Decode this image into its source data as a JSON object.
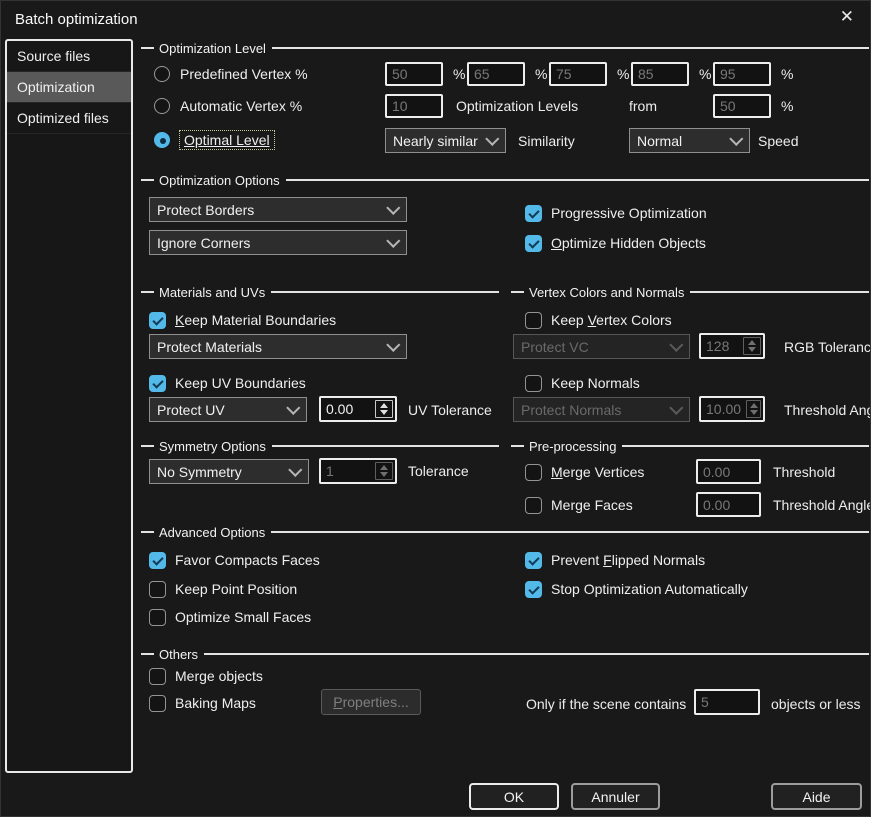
{
  "window": {
    "title": "Batch optimization",
    "close_icon": "✕"
  },
  "colors": {
    "checkbox_accent": "#53b9e9",
    "check_glyph": "#123a52",
    "selected_tab_bg": "#595959"
  },
  "sidebar": {
    "items": [
      {
        "label": "Source files",
        "selected": false
      },
      {
        "label": "Optimization",
        "selected": true
      },
      {
        "label": "Optimized files",
        "selected": false
      }
    ]
  },
  "optimization_level": {
    "header": "Optimization Level",
    "radios": [
      {
        "label": "Predefined Vertex %",
        "selected": false
      },
      {
        "label": "Automatic Vertex %",
        "selected": false
      },
      {
        "label": "Optimal Level",
        "selected": true
      }
    ],
    "predefined_values": [
      "50",
      "65",
      "75",
      "85",
      "95"
    ],
    "percent": "%",
    "auto_value": "10",
    "levels_label": "Optimization Levels",
    "from_label": "from",
    "from_value": "50",
    "similarity_value": "Nearly similar",
    "similarity_label": "Similarity",
    "speed_value": "Normal",
    "speed_label": "Speed"
  },
  "optimization_options": {
    "header": "Optimization Options",
    "protect_borders": "Protect Borders",
    "ignore_corners": "Ignore Corners",
    "progressive": {
      "text": "Progressive Optimization",
      "u": -1,
      "checked": true
    },
    "optimize_hidden": {
      "text": "Optimize Hidden Objects",
      "u": 0,
      "checked": true
    }
  },
  "materials_uvs": {
    "header": "Materials and UVs",
    "keep_material": {
      "text": "Keep Material Boundaries",
      "u": 0,
      "checked": true
    },
    "protect_materials": "Protect Materials",
    "keep_uv": {
      "text": "Keep UV Boundaries",
      "u": -1,
      "checked": true
    },
    "protect_uv": "Protect UV",
    "uv_tolerance_value": "0.00",
    "uv_tolerance_label": "UV Tolerance"
  },
  "vertex_normals": {
    "header": "Vertex Colors and Normals",
    "keep_vc": {
      "text": "Keep Vertex Colors",
      "u": 5,
      "checked": false
    },
    "protect_vc": "Protect VC",
    "rgb_value": "128",
    "rgb_label": "RGB Tolerance",
    "keep_normals": {
      "text": "Keep Normals",
      "u": -1,
      "checked": false
    },
    "protect_normals": "Protect Normals",
    "angle_value": "10.00",
    "angle_label": "Threshold Angle"
  },
  "symmetry": {
    "header": "Symmetry Options",
    "dropdown_value": "No Symmetry",
    "tolerance_value": "1",
    "tolerance_label": "Tolerance"
  },
  "preprocessing": {
    "header": "Pre-processing",
    "merge_vertices": {
      "text": "Merge Vertices",
      "u": 0,
      "checked": false
    },
    "threshold_value": "0.00",
    "threshold_label": "Threshold",
    "merge_faces": {
      "text": "Merge Faces",
      "u": -1,
      "checked": false
    },
    "threshold_angle_value": "0.00",
    "threshold_angle_label": "Threshold Angle"
  },
  "advanced": {
    "header": "Advanced Options",
    "favor_compacts": {
      "text": "Favor Compacts Faces",
      "u": -1,
      "checked": true
    },
    "keep_point": {
      "text": "Keep Point Position",
      "u": -1,
      "checked": false
    },
    "optimize_small": {
      "text": "Optimize Small Faces",
      "u": -1,
      "checked": false
    },
    "prevent_flipped": {
      "text": "Prevent Flipped Normals",
      "u": 8,
      "checked": true
    },
    "stop_auto": {
      "text": "Stop Optimization Automatically",
      "u": -1,
      "checked": true
    }
  },
  "others": {
    "header": "Others",
    "merge_objects": {
      "text": "Merge objects",
      "u": -1,
      "checked": false
    },
    "baking_maps": {
      "text": "Baking Maps",
      "u": -1,
      "checked": false
    },
    "properties_button": {
      "text": "Properties...",
      "u": 0
    },
    "scene_label": "Only if the scene contains",
    "scene_value": "5",
    "objects_label": "objects or less"
  },
  "footer": {
    "ok_label": "OK",
    "cancel_label": "Annuler",
    "help_label": "Aide"
  }
}
